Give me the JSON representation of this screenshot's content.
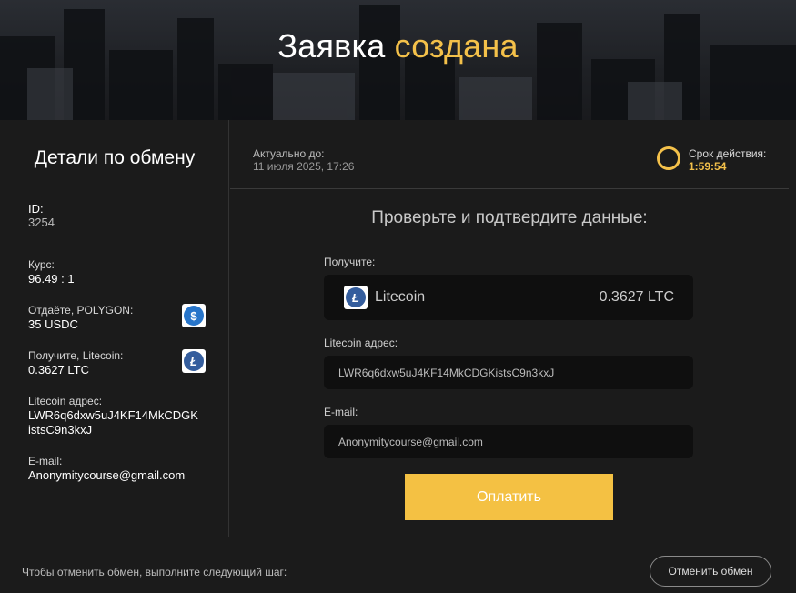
{
  "hero": {
    "title_main": "Заявка",
    "title_accent": "создана"
  },
  "details": {
    "title": "Детали по обмену",
    "id_label": "ID:",
    "id_value": "3254",
    "rate_label": "Курс:",
    "rate_value": "96.49 : 1",
    "give_label": "Отдаёте, POLYGON:",
    "give_value": "35 USDC",
    "give_icon": "usdc-icon",
    "receive_label": "Получите, Litecoin:",
    "receive_value": "0.3627 LTC",
    "receive_icon": "litecoin-icon",
    "address_label": "Litecoin адрес:",
    "address_value": "LWR6q6dxw5uJ4KF14MkCDGKistsC9n3kxJ",
    "address_line1": "LWR6q6dxw5uJ4KF14MkCDGK",
    "address_line2": "istsC9n3kxJ",
    "email_label": "E-mail:",
    "email_value": "Anonymitycourse@gmail.com"
  },
  "status": {
    "actual_label": "Актуально до:",
    "actual_value": "11 июля 2025, 17:26",
    "timer_label": "Срок действия:",
    "timer_value": "1:59:54"
  },
  "confirm": {
    "title": "Проверьте и подтвердите данные:",
    "receive_label": "Получите:",
    "receive_coin": "Litecoin",
    "receive_amount": "0.3627 LTC",
    "address_label": "Litecoin адрес:",
    "address_value": "LWR6q6dxw5uJ4KF14MkCDGKistsC9n3kxJ",
    "email_label": "E-mail:",
    "email_value": "Anonymitycourse@gmail.com",
    "pay_label": "Оплатить"
  },
  "cancel": {
    "text": "Чтобы отменить обмен, выполните следующий шаг:",
    "button_label": "Отменить обмен"
  },
  "colors": {
    "accent": "#f4c14a",
    "usdc": "#2775ca",
    "litecoin": "#345d9d"
  }
}
